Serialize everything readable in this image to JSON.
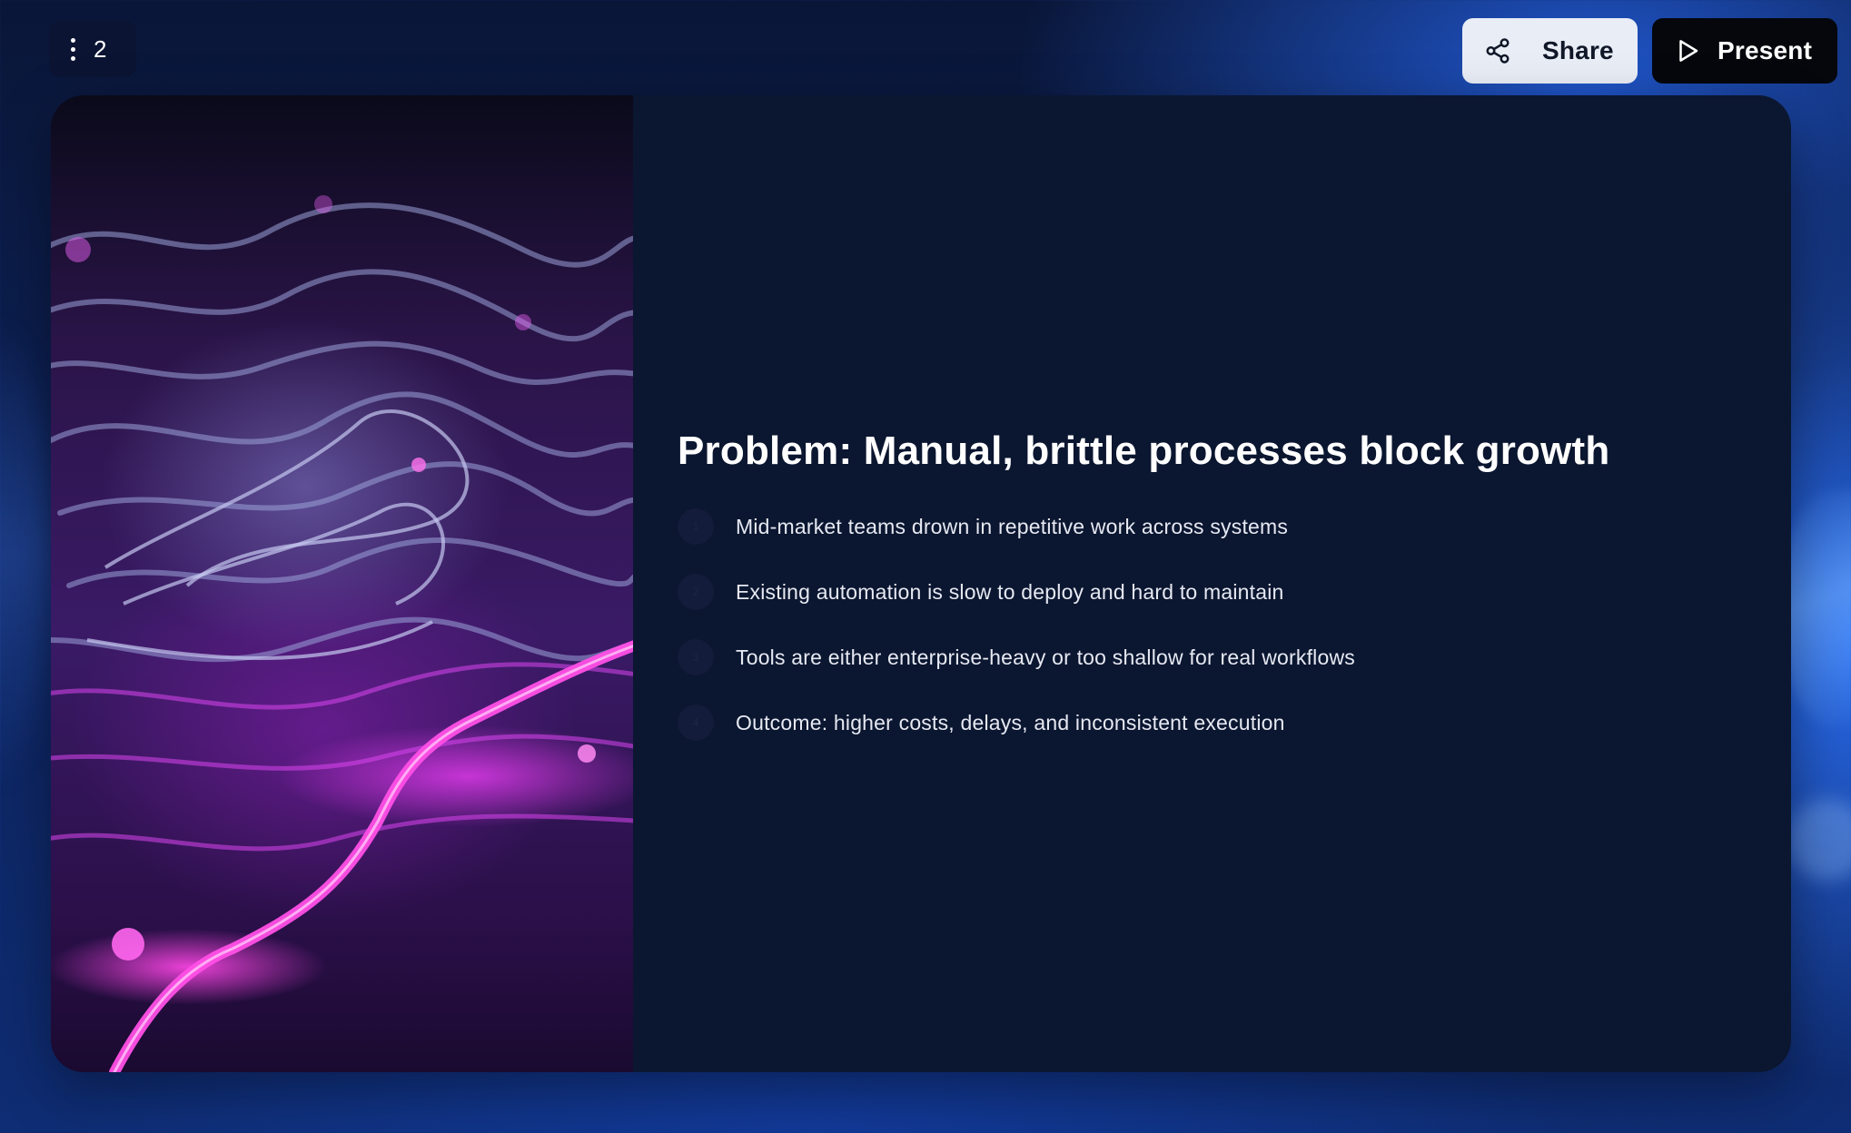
{
  "toolbar": {
    "menu_icon": "kebab-menu-icon",
    "slide_number": "2",
    "share_label": "Share",
    "share_icon": "share-icon",
    "present_label": "Present",
    "present_icon": "play-icon"
  },
  "slide": {
    "image": "abstract-purple-circuit-wires",
    "title": "Problem: Manual, brittle processes block growth",
    "bullets": [
      {
        "number": "1",
        "text": "Mid-market teams drown in repetitive work across systems"
      },
      {
        "number": "2",
        "text": "Existing automation is slow to deploy and hard to maintain"
      },
      {
        "number": "3",
        "text": "Tools are either enterprise-heavy or too shallow for real workflows"
      },
      {
        "number": "4",
        "text": "Outcome: higher costs, delays, and inconsistent execution"
      }
    ]
  },
  "colors": {
    "background": "#0d245e",
    "slide_background": "#0b1630",
    "share_button": "#e9edf6",
    "present_button": "#05070d",
    "accent_magenta": "#ff46e6"
  }
}
